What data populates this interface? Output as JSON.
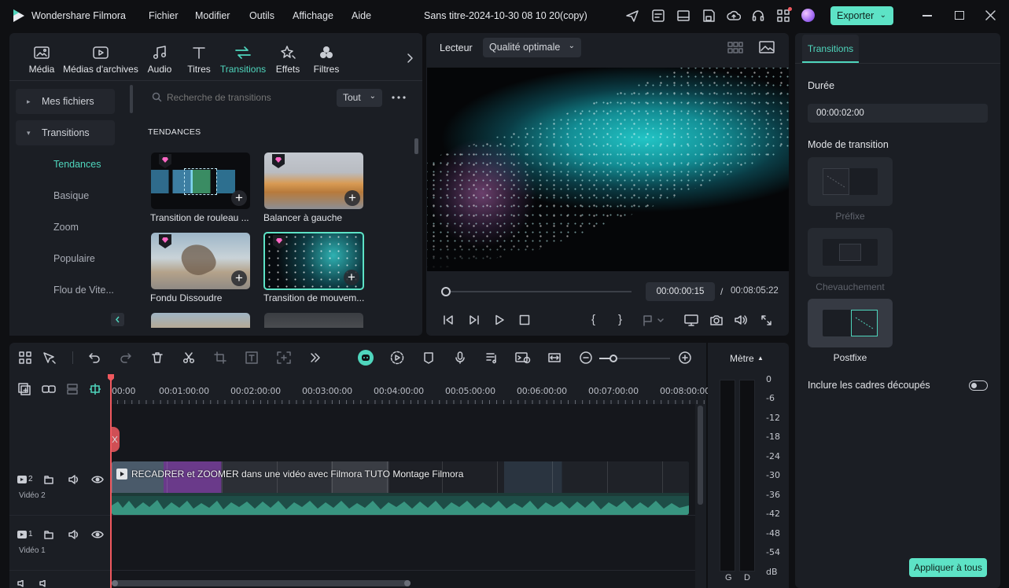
{
  "titlebar": {
    "app_name": "Wondershare Filmora",
    "menus": [
      "Fichier",
      "Modifier",
      "Outils",
      "Affichage",
      "Aide"
    ],
    "project_title": "Sans titre-2024-10-30 08 10 20(copy)",
    "export_label": "Exporter"
  },
  "media_tabs": [
    {
      "label": "Média",
      "icon": "media-icon"
    },
    {
      "label": "Médias d'archives",
      "icon": "stock-media-icon"
    },
    {
      "label": "Audio",
      "icon": "music-icon"
    },
    {
      "label": "Titres",
      "icon": "titles-icon"
    },
    {
      "label": "Transitions",
      "icon": "transitions-icon",
      "active": true
    },
    {
      "label": "Effets",
      "icon": "effects-icon"
    },
    {
      "label": "Filtres",
      "icon": "filters-icon"
    }
  ],
  "sidebar": {
    "my_files": "Mes fichiers",
    "transitions": "Transitions",
    "sub_items": [
      "Tendances",
      "Basique",
      "Zoom",
      "Populaire",
      "Flou de Vite..."
    ],
    "active_sub": "Tendances"
  },
  "browser": {
    "search_placeholder": "Recherche de transitions",
    "filter_value": "Tout",
    "section_title": "TENDANCES",
    "cards": [
      {
        "label": "Transition de rouleau ..."
      },
      {
        "label": "Balancer à gauche"
      },
      {
        "label": "Fondu Dissoudre"
      },
      {
        "label": "Transition de mouvem..."
      }
    ]
  },
  "player": {
    "label": "Lecteur",
    "quality": "Qualité optimale",
    "current_time": "00:00:00:15",
    "separator": "/",
    "total_time": "00:08:05:22",
    "progress": 0.0
  },
  "inspector": {
    "tab": "Transitions",
    "duration_label": "Durée",
    "duration_value": "00:00:02:00",
    "mode_label": "Mode de transition",
    "modes": [
      "Préfixe",
      "Chevauchement",
      "Postfixe"
    ],
    "active_mode": "Postfixe",
    "include_label": "Inclure les cadres découpés",
    "include_on": false,
    "apply_all": "Appliquer à tous"
  },
  "timeline": {
    "ruler": [
      "00:00",
      "00:01:00:00",
      "00:02:00:00",
      "00:03:00:00",
      "00:04:00:00",
      "00:05:00:00",
      "00:06:00:00",
      "00:07:00:00",
      "00:08:00:00"
    ],
    "clip_title": "RECADRER et ZOOMER dans une vidéo avec Filmora  TUTO Montage Filmora",
    "tracks": [
      {
        "num": "2",
        "name": "Vidéo 2"
      },
      {
        "num": "1",
        "name": "Vidéo 1"
      }
    ]
  },
  "meter": {
    "label": "Mètre",
    "scale": [
      "0",
      "-6",
      "-12",
      "-18",
      "-24",
      "-30",
      "-36",
      "-42",
      "-48",
      "-54",
      "dB"
    ],
    "channels": [
      "G",
      "D"
    ]
  },
  "colors": {
    "accent": "#4fd6bd",
    "export_bg": "#5de3c6",
    "playhead": "#f0595f",
    "panel": "#1b1e24"
  }
}
